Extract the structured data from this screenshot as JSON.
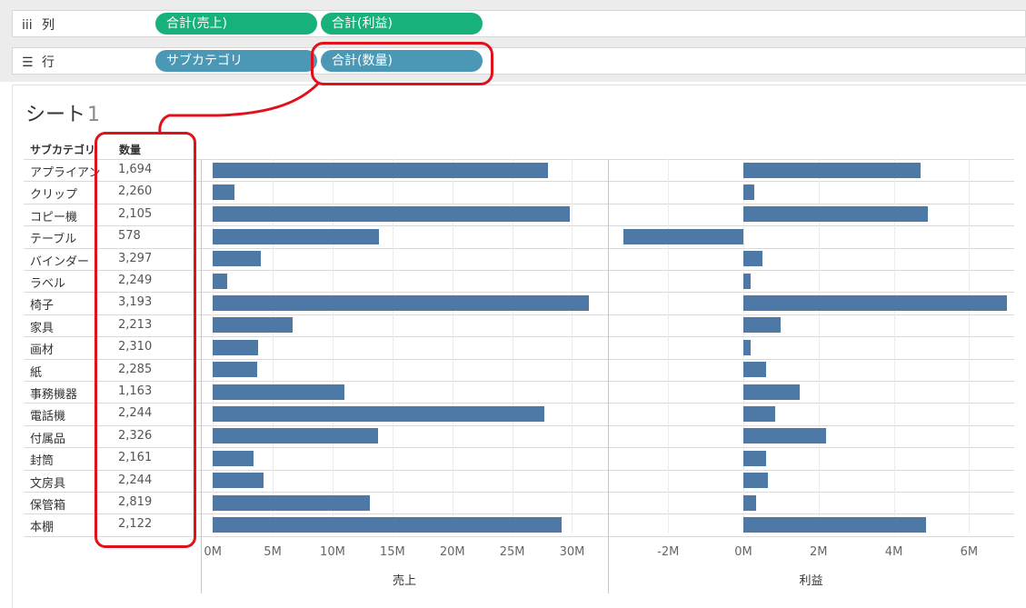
{
  "shelves": {
    "columns": {
      "icon": "iii",
      "label": "列",
      "pills": [
        "合計(売上)",
        "合計(利益)"
      ]
    },
    "rows": {
      "icon": "☰",
      "label": "行",
      "pills": [
        "サブカテゴリ",
        "合計(数量)"
      ]
    }
  },
  "sheet": {
    "title": "シート",
    "title_num": "1"
  },
  "table_headers": {
    "category": "サブカテゴリ",
    "quantity": "数量"
  },
  "chart_data": {
    "type": "bar",
    "categories": [
      "アプライアンス",
      "クリップ",
      "コピー機",
      "テーブル",
      "バインダー",
      "ラベル",
      "椅子",
      "家具",
      "画材",
      "紙",
      "事務機器",
      "電話機",
      "付属品",
      "封筒",
      "文房具",
      "保管箱",
      "本棚"
    ],
    "quantity": [
      "1,694",
      "2,260",
      "2,105",
      "578",
      "3,297",
      "2,249",
      "3,193",
      "2,213",
      "2,310",
      "2,285",
      "1,163",
      "2,244",
      "2,326",
      "2,161",
      "2,244",
      "2,819",
      "2,122"
    ],
    "series": [
      {
        "name": "売上",
        "values": [
          28.0,
          1.8,
          29.8,
          13.9,
          4.0,
          1.2,
          31.4,
          6.7,
          3.8,
          3.7,
          11.0,
          27.7,
          13.8,
          3.4,
          4.2,
          13.1,
          29.1
        ],
        "xlim": [
          -1,
          33
        ],
        "ticks": [
          0,
          5,
          10,
          15,
          20,
          25,
          30
        ],
        "tick_labels": [
          "0M",
          "5M",
          "10M",
          "15M",
          "20M",
          "25M",
          "30M"
        ],
        "axis_title": "売上"
      },
      {
        "name": "利益",
        "values": [
          4.7,
          0.3,
          4.9,
          -3.2,
          0.5,
          0.2,
          7.0,
          1.0,
          0.2,
          0.6,
          1.5,
          0.85,
          2.2,
          0.6,
          0.65,
          0.35,
          4.85
        ],
        "xlim": [
          -3.6,
          7.2
        ],
        "ticks": [
          -2,
          0,
          2,
          4,
          6
        ],
        "tick_labels": [
          "-2M",
          "0M",
          "2M",
          "4M",
          "6M"
        ],
        "axis_title": "利益"
      }
    ],
    "bar_color": "#4e79a7"
  },
  "colors": {
    "pill_green": "#17b27b",
    "pill_blue": "#4a98b5",
    "highlight": "#e0111b"
  }
}
